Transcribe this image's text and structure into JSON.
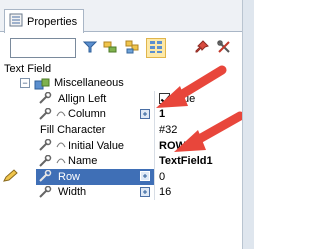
{
  "tab": {
    "label": "Properties"
  },
  "toolbar": {
    "search_value": "",
    "search_placeholder": ""
  },
  "object_label": "Text Field",
  "category": {
    "label": "Miscellaneous"
  },
  "properties": [
    {
      "name": "Allign Left",
      "value": "True",
      "checkbox": true,
      "bold": false
    },
    {
      "name": "Column",
      "value": "1",
      "bold": true
    },
    {
      "name": "Fill Character",
      "value": "#32",
      "bold": false
    },
    {
      "name": "Initial Value",
      "value": "ROW1",
      "bold": true
    },
    {
      "name": "Name",
      "value": "TextField1",
      "bold": true
    },
    {
      "name": "Row",
      "value": "0",
      "bold": false,
      "selected": true
    },
    {
      "name": "Width",
      "value": "16",
      "bold": false
    }
  ],
  "colors": {
    "accent": "#3f6fb6",
    "arrow": "#e8463b",
    "tab_border": "#a9b6c6"
  }
}
